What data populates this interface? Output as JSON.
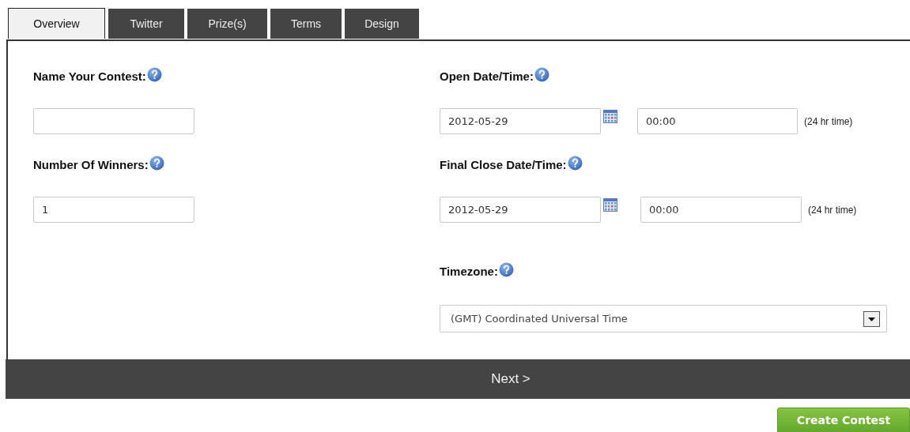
{
  "tabs": [
    {
      "label": "Overview",
      "selected": true
    },
    {
      "label": "Twitter",
      "selected": false
    },
    {
      "label": "Prize(s)",
      "selected": false
    },
    {
      "label": "Terms",
      "selected": false
    },
    {
      "label": "Design",
      "selected": false
    }
  ],
  "left_fields": [
    {
      "label": "Name Your Contest:"
    },
    {
      "label": "Number Of Winners:",
      "value": "1"
    }
  ],
  "date_fields": [
    {
      "label": "Open Date/Time:",
      "date": "2012-05-29",
      "time": "00:00",
      "note": "(24 hr time)"
    },
    {
      "label": "Final Close Date/Time:",
      "date": "2012-05-29",
      "time": "00:00",
      "note": "(24 hr time)"
    }
  ],
  "timezone": {
    "label": "Timezone:",
    "value": "(GMT) Coordinated Universal Time"
  },
  "next_button": "Next >",
  "create_button": "Create Contest"
}
